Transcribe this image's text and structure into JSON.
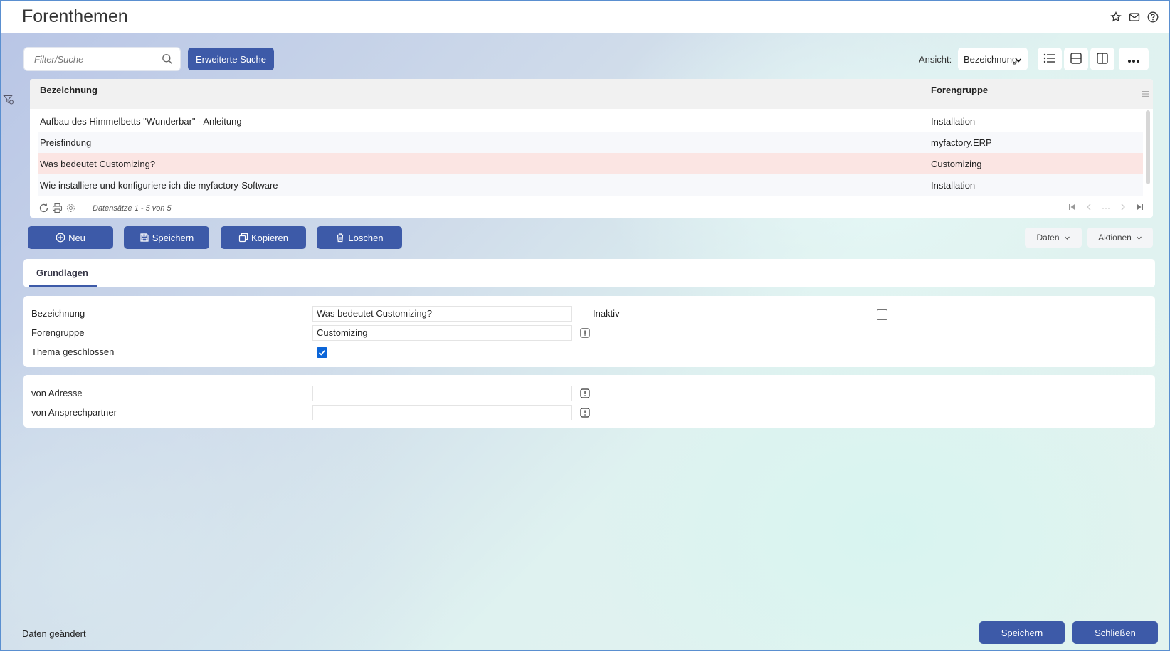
{
  "window": {
    "title": "Forenthemen"
  },
  "title_icons": [
    "star-icon",
    "mail-icon",
    "help-icon"
  ],
  "toolbar": {
    "search_placeholder": "Filter/Suche",
    "extended_search_label": "Erweiterte Suche",
    "view_label": "Ansicht:",
    "view_selected": "Bezeichnung"
  },
  "grid": {
    "columns": [
      "Bezeichnung",
      "Forengruppe"
    ],
    "rows": [
      {
        "bezeichnung": "Aufbau des Himmelbetts \"Wunderbar\" - Anleitung",
        "forengruppe": "Installation"
      },
      {
        "bezeichnung": "Preisfindung",
        "forengruppe": "myfactory.ERP"
      },
      {
        "bezeichnung": "Was bedeutet Customizing?",
        "forengruppe": "Customizing"
      },
      {
        "bezeichnung": "Wie installiere und konfiguriere ich die myfactory-Software",
        "forengruppe": "Installation"
      }
    ],
    "selected_row": 2,
    "record_count": "Datensätze 1 - 5 von 5",
    "pager_middle": "···"
  },
  "actions": {
    "new": "Neu",
    "save": "Speichern",
    "copy": "Kopieren",
    "delete": "Löschen",
    "data_menu": "Daten",
    "actions_menu": "Aktionen"
  },
  "tabs": [
    {
      "label": "Grundlagen",
      "active": true
    }
  ],
  "form": {
    "bezeichnung_label": "Bezeichnung",
    "bezeichnung_value": "Was bedeutet Customizing?",
    "inaktiv_label": "Inaktiv",
    "inaktiv_checked": false,
    "forengruppe_label": "Forengruppe",
    "forengruppe_value": "Customizing",
    "thema_geschlossen_label": "Thema geschlossen",
    "thema_geschlossen_checked": true,
    "von_adresse_label": "von Adresse",
    "von_adresse_value": "",
    "von_ansprechpartner_label": "von Ansprechpartner",
    "von_ansprechpartner_value": ""
  },
  "footer": {
    "status": "Daten geändert",
    "save": "Speichern",
    "close": "Schließen"
  },
  "colors": {
    "primary": "#3d5aa8",
    "selected_row": "#fbe5e3",
    "checkbox": "#0b65d8"
  }
}
